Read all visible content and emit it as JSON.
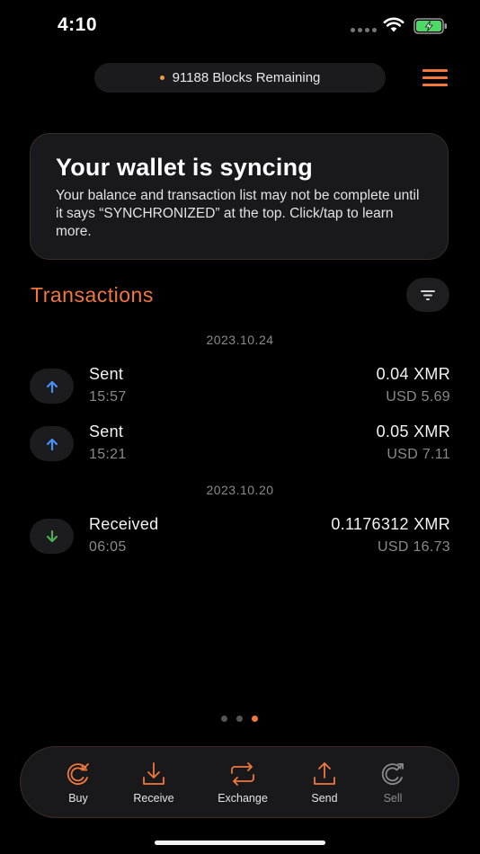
{
  "status_bar": {
    "time": "4:10"
  },
  "header": {
    "sync_status": "91188 Blocks Remaining",
    "accent_color": "#f0783c"
  },
  "sync_card": {
    "title": "Your wallet is syncing",
    "body": "Your balance and transaction list may not be complete until it says “SYNCHRONIZED” at the top. Click/tap to learn more."
  },
  "transactions": {
    "title": "Transactions",
    "groups": [
      {
        "date": "2023.10.24",
        "items": [
          {
            "type": "Sent",
            "time": "15:57",
            "amount": "0.04 XMR",
            "fiat": "USD 5.69",
            "direction": "out"
          },
          {
            "type": "Sent",
            "time": "15:21",
            "amount": "0.05 XMR",
            "fiat": "USD 7.11",
            "direction": "out"
          }
        ]
      },
      {
        "date": "2023.10.20",
        "items": [
          {
            "type": "Received",
            "time": "06:05",
            "amount": "0.1176312 XMR",
            "fiat": "USD 16.73",
            "direction": "in"
          }
        ]
      }
    ]
  },
  "pager": {
    "count": 3,
    "active_index": 2
  },
  "actions": [
    {
      "label": "Buy",
      "icon": "buy-icon"
    },
    {
      "label": "Receive",
      "icon": "download-icon"
    },
    {
      "label": "Exchange",
      "icon": "exchange-icon"
    },
    {
      "label": "Send",
      "icon": "upload-icon"
    },
    {
      "label": "Sell",
      "icon": "sell-icon"
    }
  ]
}
